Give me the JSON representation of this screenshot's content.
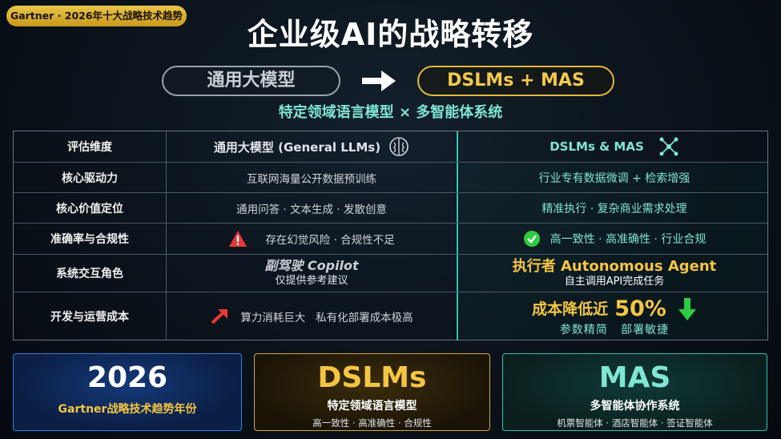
{
  "badge": "Gartner · 2026年十大战略技术趋势",
  "title": "企业级AI的战略转移",
  "pill_left": "通用大模型",
  "pill_right": "DSLMs + MAS",
  "subtitle": "特定领域语言模型 × 多智能体系统",
  "table": {
    "header": {
      "c1": "评估维度",
      "c2": "通用大模型 (General LLMs)",
      "c3": "DSLMs & MAS"
    },
    "rows": [
      {
        "c1": "核心驱动力",
        "c2": "互联网海量公开数据预训练",
        "c3": "行业专有数据微调 + 检索增强"
      },
      {
        "c1": "核心价值定位",
        "c2": "通用问答 · 文本生成 · 发散创意",
        "c3": "精准执行 · 复杂商业需求处理"
      },
      {
        "c1": "准确率与合规性",
        "c2": "存在幻觉风险 · 合规性不足",
        "c3": "高一致性 · 高准确性 · 行业合规"
      },
      {
        "c1": "系统交互角色",
        "c2_main": "副驾驶 Copilot",
        "c2_sub": "仅提供参考建议",
        "c3_main": "执行者 Autonomous Agent",
        "c3_sub": "自主调用API完成任务"
      },
      {
        "c1": "开发与运营成本",
        "c2": "算力消耗巨大   私有化部署成本极高",
        "c3_main": "成本降低近",
        "c3_pct": "50%",
        "c3_sub": "参数精简   部署敏捷"
      }
    ]
  },
  "cards": [
    {
      "big": "2026",
      "mid": "Gartner战略技术趋势年份"
    },
    {
      "big": "DSLMs",
      "mid": "特定领域语言模型",
      "small": "高一致性 · 高准确性 · 合规性"
    },
    {
      "big": "MAS",
      "mid": "多智能体协作系统",
      "small": "机票智能体 · 酒店智能体 · 签证智能体"
    }
  ],
  "colors": {
    "gold": "#f4c542",
    "teal": "#7fe6d2",
    "blue": "#2f7fe6",
    "warning_red": "#e53935",
    "check_green": "#2ecc40"
  },
  "icons": [
    "brain-icon",
    "network-icon",
    "warning-icon",
    "check-icon",
    "trend-up-icon",
    "arrow-down-icon",
    "arrow-right-icon"
  ]
}
